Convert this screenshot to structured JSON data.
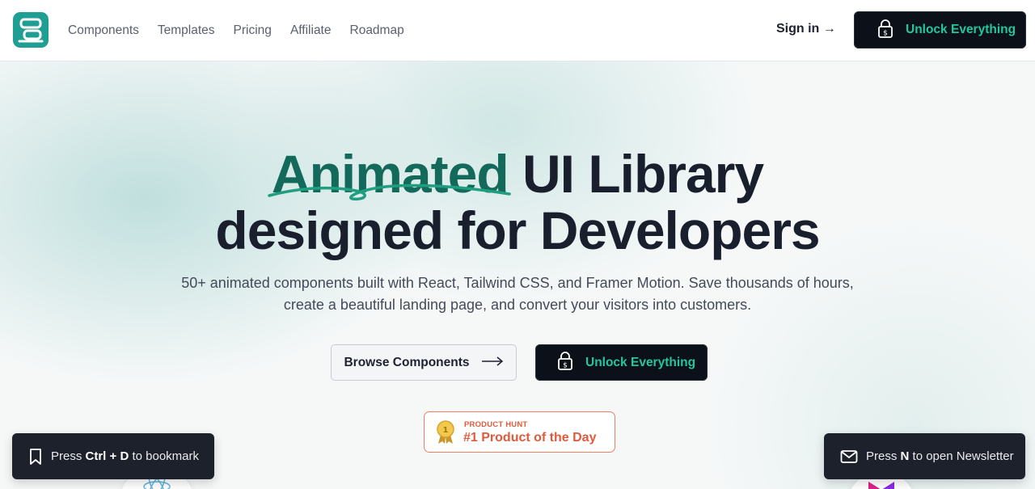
{
  "header": {
    "nav": [
      "Components",
      "Templates",
      "Pricing",
      "Affiliate",
      "Roadmap"
    ],
    "signin": "Sign in →",
    "cta": "Unlock Everything"
  },
  "hero": {
    "title_accent": "Animated",
    "title_rest": " UI Library",
    "title_line2": "designed for Developers",
    "subtitle": "50+ animated components built with React, Tailwind CSS, and Framer Motion. Save thousands of hours, create a beautiful landing page, and convert your visitors into customers.",
    "browse_button": "Browse Components",
    "unlock_button": "Unlock Everything"
  },
  "product_hunt": {
    "label": "PRODUCT HUNT",
    "title": "#1 Product of the Day",
    "medal_number": "1"
  },
  "toasts": {
    "bookmark": {
      "pre": "Press ",
      "key1": "Ctrl",
      "plus": " + ",
      "key2": "D",
      "post": " to bookmark"
    },
    "newsletter": {
      "pre": "Press ",
      "key": "N",
      "post": " to open Newsletter"
    }
  },
  "colors": {
    "brand_teal": "#1f9e93",
    "accent_green": "#22c7a0",
    "title_accent": "#146a5a",
    "product_hunt": "#df5b3c",
    "dark_button": "#0c1018"
  },
  "icons": {
    "lock": "lock-dollar-icon",
    "bookmark": "bookmark-icon",
    "mail": "mail-icon",
    "arrow": "long-arrow-right-icon"
  }
}
